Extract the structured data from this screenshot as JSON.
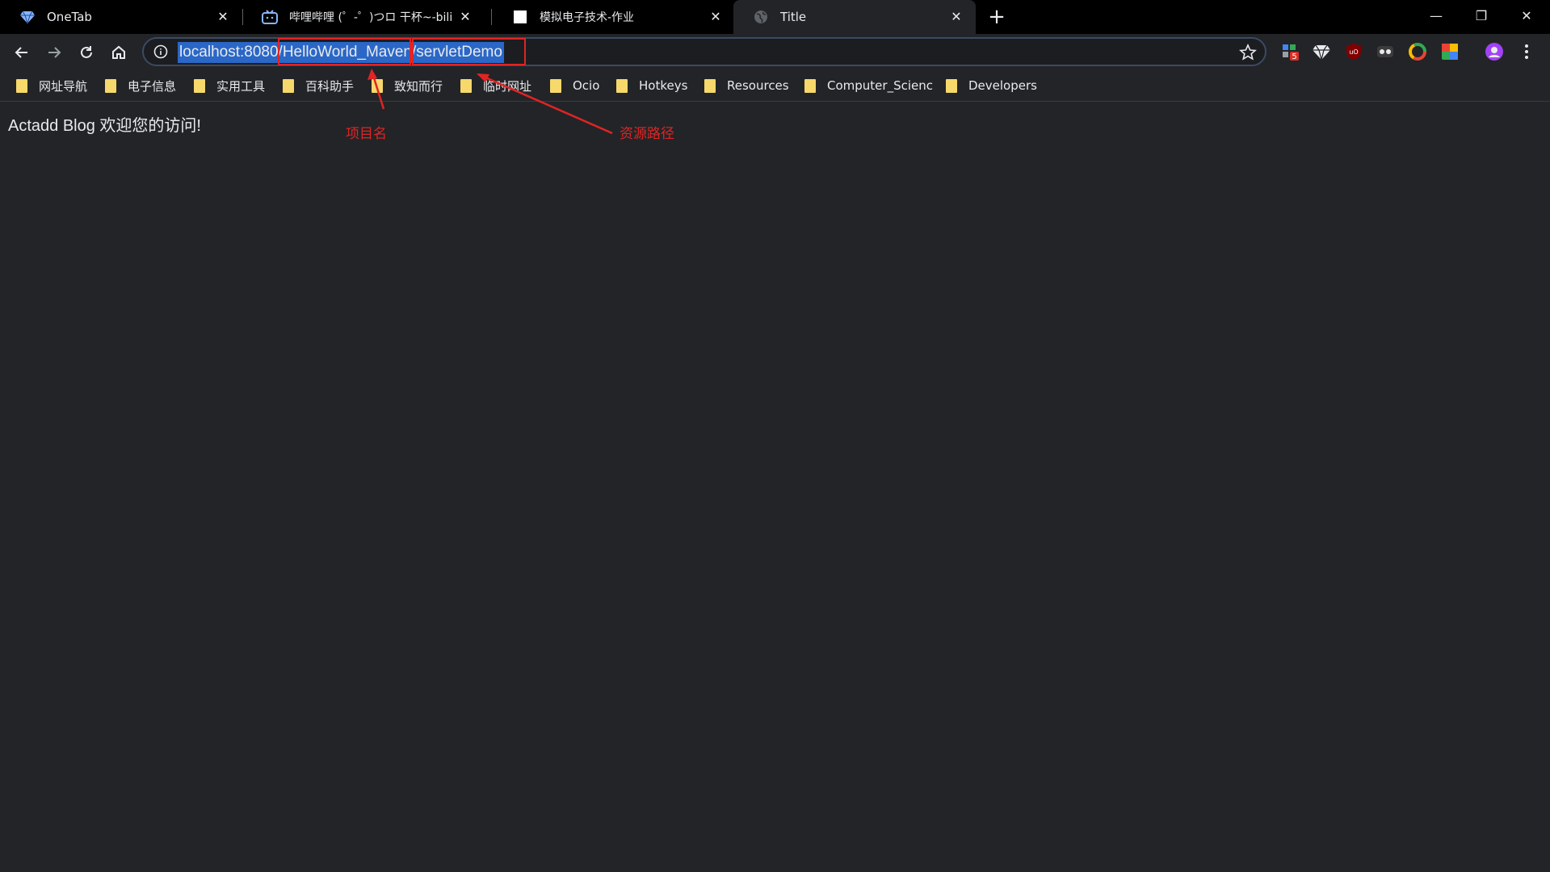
{
  "tabs": [
    {
      "title": "OneTab",
      "icon": "onetab-diamond-icon"
    },
    {
      "title": "哔哩哔哩 (゜-゜)つロ 干杯~-bili",
      "icon": "bilibili-tv-icon"
    },
    {
      "title": "模拟电子技术-作业",
      "icon": "blank-page-icon"
    },
    {
      "title": "Title",
      "icon": "globe-icon",
      "active": true
    }
  ],
  "window_controls": {
    "minimize": "—",
    "restore": "❐",
    "close": "✕"
  },
  "address_bar": {
    "url": "localhost:8080/HelloWorld_Maven/servletDemo",
    "url_parts": [
      "localhost:8080/",
      "HelloWorld_Maven",
      "/",
      "servletDemo"
    ]
  },
  "extensions_badge": "5",
  "bookmarks": [
    "网址导航",
    "电子信息",
    "实用工具",
    "百科助手",
    "致知而行",
    "临时网址",
    "Ocio",
    "Hotkeys",
    "Resources",
    "Computer_Scienc",
    "Developers"
  ],
  "page": {
    "text": "Actadd Blog 欢迎您的访问!"
  },
  "annotations": {
    "project_label": "项目名",
    "resource_label": "资源路径",
    "color": "#e02424"
  }
}
